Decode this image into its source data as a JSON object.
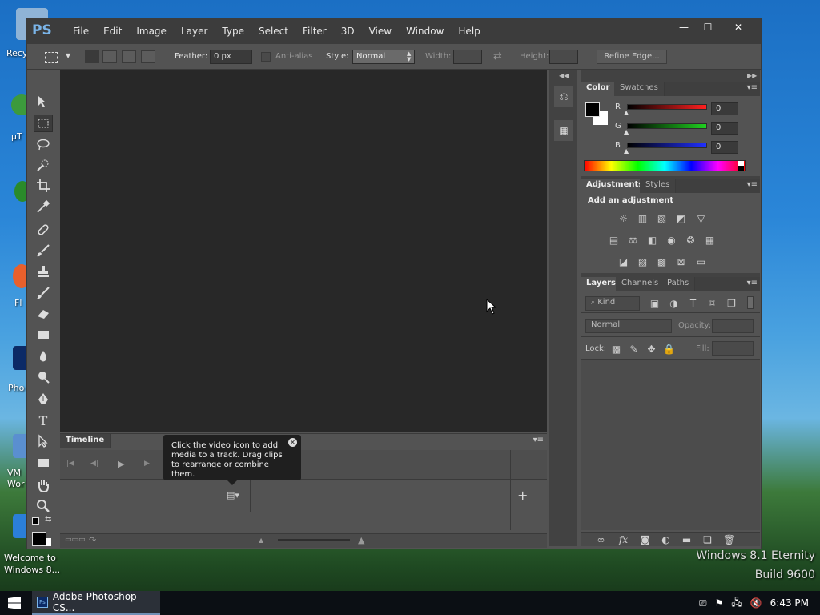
{
  "desktop": {
    "labels": [
      "Recy",
      "μT",
      "",
      "Fl",
      "Pho",
      "VM Wor",
      "Welcome to Windows 8..."
    ],
    "watermark_line1": "Windows 8.1 Eternity",
    "watermark_line2": "Build 9600"
  },
  "taskbar": {
    "app_label": "Adobe Photoshop CS...",
    "time": "6:43 PM"
  },
  "window": {
    "logo": "PS",
    "menu": [
      "File",
      "Edit",
      "Image",
      "Layer",
      "Type",
      "Select",
      "Filter",
      "3D",
      "View",
      "Window",
      "Help"
    ],
    "controls": {
      "minimize": "—",
      "maximize": "☐",
      "close": "✕"
    }
  },
  "options": {
    "feather_label": "Feather:",
    "feather_value": "0 px",
    "antialias_label": "Anti-alias",
    "style_label": "Style:",
    "style_value": "Normal",
    "width_label": "Width:",
    "height_label": "Height:",
    "refine_label": "Refine Edge..."
  },
  "timeline": {
    "tab": "Timeline",
    "tooltip": "Click the video icon to add media to a track. Drag clips to rearrange or combine them."
  },
  "color_panel": {
    "tabs": [
      "Color",
      "Swatches"
    ],
    "channels": [
      {
        "label": "R",
        "value": "0",
        "color": "#ff2020"
      },
      {
        "label": "G",
        "value": "0",
        "color": "#20d020"
      },
      {
        "label": "B",
        "value": "0",
        "color": "#2030ff"
      }
    ]
  },
  "adjustments_panel": {
    "tabs": [
      "Adjustments",
      "Styles"
    ],
    "heading": "Add an adjustment"
  },
  "layers_panel": {
    "tabs": [
      "Layers",
      "Channels",
      "Paths"
    ],
    "kind_label": "Kind",
    "blend_value": "Normal",
    "opacity_label": "Opacity:",
    "lock_label": "Lock:",
    "fill_label": "Fill:"
  }
}
